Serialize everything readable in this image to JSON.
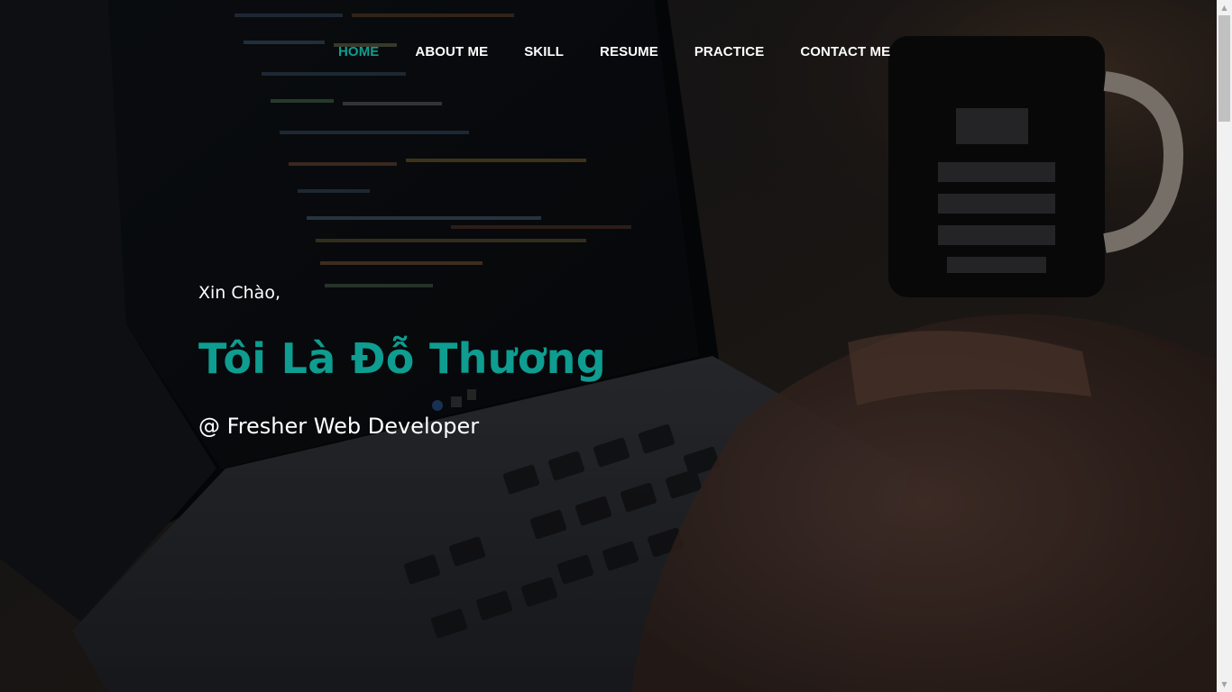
{
  "nav": {
    "items": [
      {
        "label": "HOME",
        "active": true
      },
      {
        "label": "ABOUT ME",
        "active": false
      },
      {
        "label": "SKILL",
        "active": false
      },
      {
        "label": "RESUME",
        "active": false
      },
      {
        "label": "PRACTICE",
        "active": false
      },
      {
        "label": "CONTACT ME",
        "active": false
      }
    ]
  },
  "hero": {
    "greeting": "Xin Chào,",
    "name": "Tôi Là Đỗ Thương",
    "role": "@ Fresher Web Developer"
  },
  "colors": {
    "accent": "#0e9d90",
    "text": "#ffffff",
    "background": "#0d0f14"
  },
  "icons": {
    "scroll_up": "triangle-up-icon",
    "scroll_down": "triangle-down-icon"
  }
}
